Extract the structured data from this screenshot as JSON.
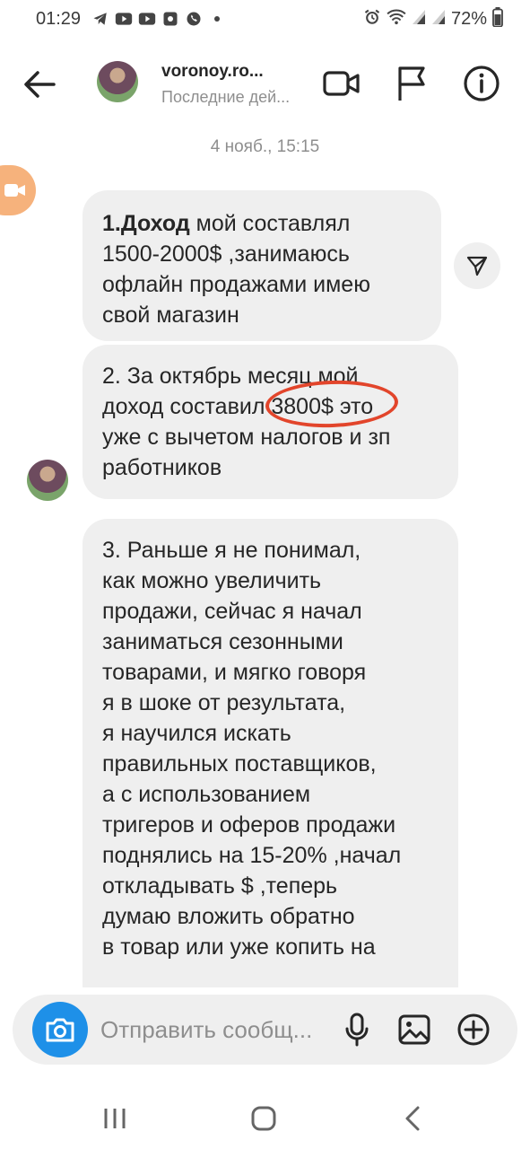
{
  "status_bar": {
    "time": "01:29",
    "battery": "72%"
  },
  "header": {
    "username": "voronoy.ro...",
    "activity": "Последние дей..."
  },
  "date_divider": "4 нояб., 15:15",
  "messages": [
    {
      "lines": [
        {
          "bold": "1.Доход",
          "rest": " мой составлял"
        },
        {
          "text": "1500-2000$ ,занимаюсь"
        },
        {
          "text": "офлайн продажами имею"
        },
        {
          "text": "свой магазин"
        }
      ]
    },
    {
      "lines": [
        "2. За октябрь месяц мой",
        "доход составил 3800$ это",
        "уже с вычетом налогов и зп",
        "работников"
      ]
    },
    {
      "lines": [
        "3. Раньше я не понимал,",
        "как можно увеличить",
        "продажи, сейчас я начал",
        "заниматься сезонными",
        "товарами, и мягко говоря",
        "я в шоке от результата,",
        "я научился искать",
        "правильных поставщиков,",
        "а с использованием",
        "тригеров и оферов продажи",
        "поднялись на 15-20% ,начал",
        "откладывать $ ,теперь",
        "думаю вложить обратно",
        "в товар или уже копить на"
      ]
    }
  ],
  "composer": {
    "placeholder": "Отправить сообщ..."
  },
  "icons": {
    "back": "arrow-left-icon",
    "video": "video-camera-icon",
    "flag": "flag-icon",
    "info": "info-icon",
    "share": "send-icon",
    "camera": "camera-icon",
    "mic": "microphone-icon",
    "gallery": "image-icon",
    "add": "plus-circle-icon"
  },
  "colors": {
    "bubble": "#efefef",
    "camera_button": "#1e90e8",
    "highlight_circle": "#e2452b",
    "video_float": "#f6b27c"
  }
}
